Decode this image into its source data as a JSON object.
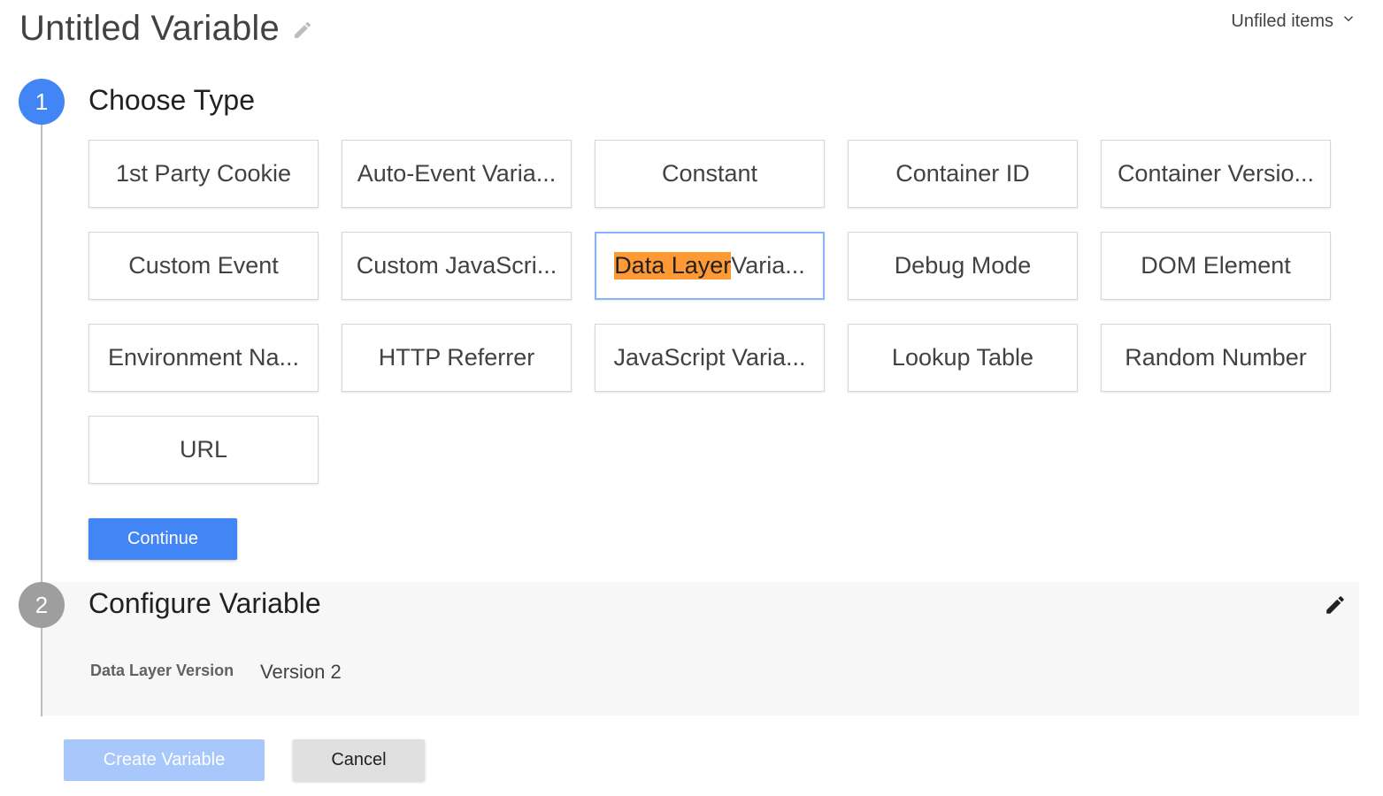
{
  "header": {
    "title": "Untitled Variable",
    "folder_label": "Unfiled items",
    "title_edit_icon": "pencil-icon",
    "folder_icon": "chevron-down-icon"
  },
  "step1": {
    "number": "1",
    "title": "Choose Type",
    "selected_index": 7,
    "types": [
      {
        "label": "1st Party Cookie"
      },
      {
        "label": "Auto-Event Varia..."
      },
      {
        "label": "Constant"
      },
      {
        "label": "Container ID"
      },
      {
        "label": "Container Versio..."
      },
      {
        "label": "Custom Event"
      },
      {
        "label": "Custom JavaScri..."
      },
      {
        "label": "Data Layer Varia...",
        "highlight": "Data Layer",
        "rest": " Varia..."
      },
      {
        "label": "Debug Mode"
      },
      {
        "label": "DOM Element"
      },
      {
        "label": "Environment Na..."
      },
      {
        "label": "HTTP Referrer"
      },
      {
        "label": "JavaScript Varia..."
      },
      {
        "label": "Lookup Table"
      },
      {
        "label": "Random Number"
      },
      {
        "label": "URL"
      }
    ],
    "continue_label": "Continue"
  },
  "step2": {
    "number": "2",
    "title": "Configure Variable",
    "edit_icon": "pencil-icon",
    "field_label": "Data Layer Version",
    "field_value": "Version 2"
  },
  "footer": {
    "create_label": "Create Variable",
    "cancel_label": "Cancel"
  },
  "colors": {
    "accent": "#4285f4",
    "accent_disabled": "#a8c7fa",
    "highlight": "#ff9933",
    "step_inactive": "#9e9e9e"
  }
}
